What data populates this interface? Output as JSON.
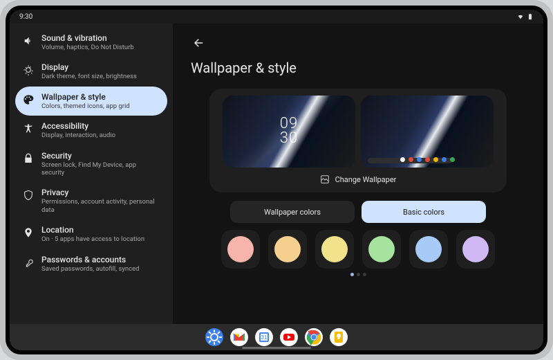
{
  "status": {
    "time": "9:30"
  },
  "sidebar": {
    "items": [
      {
        "title": "Sound & vibration",
        "sub": "Volume, haptics, Do Not Disturb"
      },
      {
        "title": "Display",
        "sub": "Dark theme, font size, brightness"
      },
      {
        "title": "Wallpaper & style",
        "sub": "Colors, themed icons, app grid"
      },
      {
        "title": "Accessibility",
        "sub": "Display, interaction, audio"
      },
      {
        "title": "Security",
        "sub": "Screen lock, Find My Device, app security"
      },
      {
        "title": "Privacy",
        "sub": "Permissions, account activity, personal data"
      },
      {
        "title": "Location",
        "sub": "On · 5 apps have access to location"
      },
      {
        "title": "Passwords & accounts",
        "sub": "Saved passwords, autofill, synced"
      }
    ]
  },
  "page": {
    "title": "Wallpaper & style",
    "change_label": "Change Wallpaper",
    "clock_top": "09",
    "clock_bottom": "30",
    "tabs": {
      "wallpaper": "Wallpaper colors",
      "basic": "Basic colors"
    },
    "swatches": [
      "#f6b4ab",
      "#f5cf8f",
      "#f2e38b",
      "#a6e39f",
      "#a7caf7",
      "#cfb8f4"
    ],
    "home_dots": [
      "#ffffff",
      "#e24b3b",
      "#3a7ef0",
      "#e24b3b",
      "#f2b400",
      "#3a7ef0",
      "#34a853"
    ]
  }
}
